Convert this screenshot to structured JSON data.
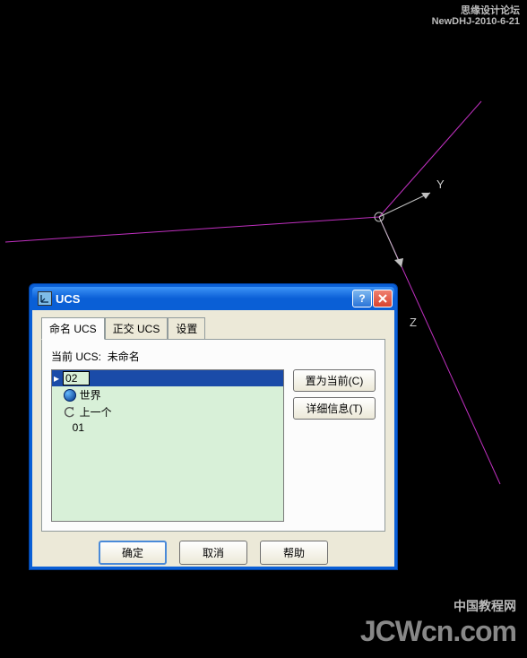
{
  "watermarks": {
    "top_line1": "思缘设计论坛",
    "top_line2": "NewDHJ-2010-6-21",
    "bottom_line1": "中国教程网",
    "bottom_line2": "JCWcn.com"
  },
  "axes": {
    "y_label": "Y",
    "z_label": "Z"
  },
  "dialog": {
    "title": "UCS",
    "tabs": {
      "named": "命名 UCS",
      "ortho": "正交 UCS",
      "settings": "设置"
    },
    "current_ucs_label": "当前 UCS:",
    "current_ucs_value": "未命名",
    "list": {
      "editing_value": "02",
      "world": "世界",
      "previous": "上一个",
      "item_01": "01"
    },
    "buttons": {
      "set_current": "置为当前(C)",
      "details": "详细信息(T)",
      "ok": "确定",
      "cancel": "取消",
      "help": "帮助"
    }
  }
}
